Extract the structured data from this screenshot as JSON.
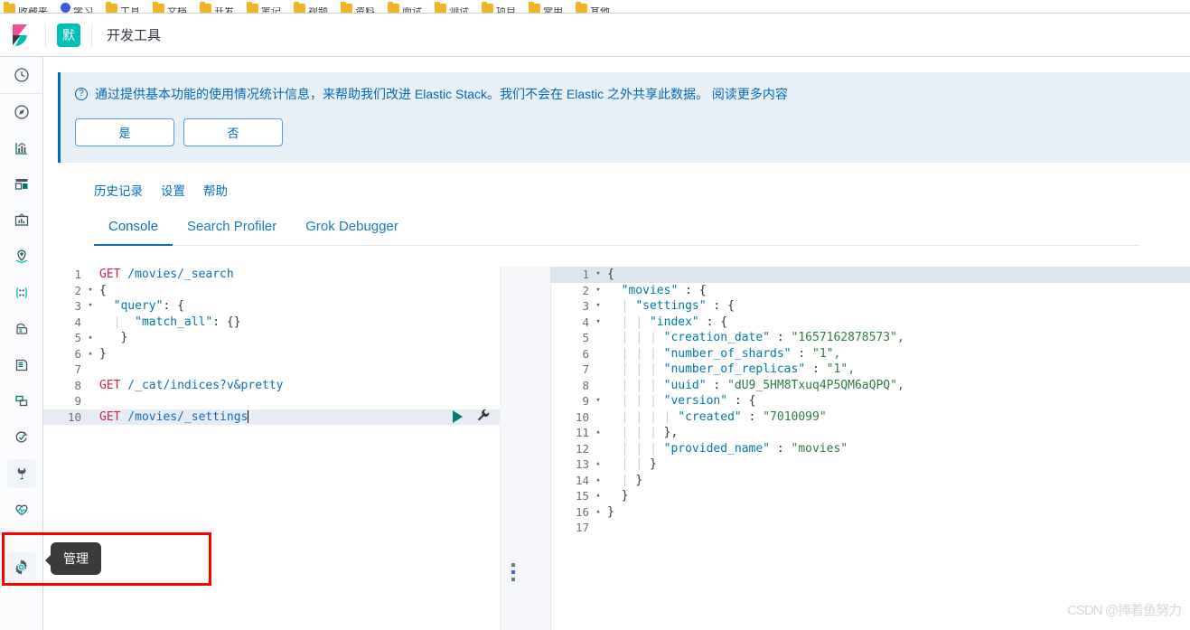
{
  "browser": {
    "bookmarks": [
      {
        "icon": "folder-icon",
        "label": "收藏夹"
      },
      {
        "icon": "globe-icon",
        "label": "学习"
      },
      {
        "icon": "folder-icon",
        "label": "工具"
      },
      {
        "icon": "folder-icon",
        "label": "文档"
      },
      {
        "icon": "folder-icon",
        "label": "开发"
      },
      {
        "icon": "folder-icon",
        "label": "笔记"
      },
      {
        "icon": "folder-icon",
        "label": "视频"
      },
      {
        "icon": "folder-icon",
        "label": "资料"
      },
      {
        "icon": "folder-icon",
        "label": "面试"
      },
      {
        "icon": "folder-icon",
        "label": "测试"
      },
      {
        "icon": "folder-icon",
        "label": "项目"
      },
      {
        "icon": "folder-icon",
        "label": "常用"
      },
      {
        "icon": "folder-icon",
        "label": "其他"
      }
    ]
  },
  "header": {
    "logo": "kibana-logo",
    "space_badge": "默",
    "title": "开发工具"
  },
  "sidebar": {
    "items": [
      {
        "name": "recently-viewed",
        "icon": "clock-icon",
        "active": false
      },
      {
        "name": "discover",
        "icon": "compass-icon",
        "active": false
      },
      {
        "name": "visualize",
        "icon": "chart-icon",
        "active": false
      },
      {
        "name": "dashboard",
        "icon": "dashboard-icon",
        "active": false
      },
      {
        "name": "canvas",
        "icon": "canvas-icon",
        "active": false
      },
      {
        "name": "maps",
        "icon": "map-marker-icon",
        "active": false
      },
      {
        "name": "machine-learning",
        "icon": "ml-icon",
        "active": false
      },
      {
        "name": "infrastructure",
        "icon": "server-icon",
        "active": false
      },
      {
        "name": "logs",
        "icon": "logs-icon",
        "active": false
      },
      {
        "name": "apm",
        "icon": "apm-icon",
        "active": false
      },
      {
        "name": "uptime",
        "icon": "uptime-icon",
        "active": false
      },
      {
        "name": "dev-tools",
        "icon": "wrench-icon",
        "active": true
      },
      {
        "name": "monitoring",
        "icon": "heartbeat-icon",
        "active": false
      },
      {
        "name": "management",
        "icon": "gear-icon",
        "active": true
      }
    ],
    "tooltip": "管理"
  },
  "callout": {
    "icon": "question-circle-icon",
    "text": "通过提供基本功能的使用情况统计信息，来帮助我们改进 Elastic Stack。我们不会在 Elastic 之外共享此数据。 阅读更多内容",
    "yes_label": "是",
    "no_label": "否"
  },
  "subnav": {
    "links": [
      {
        "label": "历史记录"
      },
      {
        "label": "设置"
      },
      {
        "label": "帮助"
      }
    ]
  },
  "tabs": [
    {
      "label": "Console",
      "active": true
    },
    {
      "label": "Search Profiler",
      "active": false
    },
    {
      "label": "Grok Debugger",
      "active": false
    }
  ],
  "editor": {
    "lines": [
      {
        "num": "1",
        "fold": "",
        "text": "GET /movies/_search",
        "type": "request",
        "method": "GET",
        "url": " /movies/_search"
      },
      {
        "num": "2",
        "fold": "▾",
        "text": "{",
        "type": "punct"
      },
      {
        "num": "3",
        "fold": "▾",
        "text": "  \"query\": {",
        "type": "keyopen",
        "key": "\"query\"",
        "tail": ": {"
      },
      {
        "num": "4",
        "fold": "",
        "text": "  |  \"match_all\": {}",
        "type": "keyval",
        "key": "\"match_all\"",
        "tail": ": {}"
      },
      {
        "num": "5",
        "fold": "▴",
        "text": "   }",
        "type": "punct"
      },
      {
        "num": "6",
        "fold": "▴",
        "text": "}",
        "type": "punct"
      },
      {
        "num": "7",
        "fold": "",
        "text": "",
        "type": "blank"
      },
      {
        "num": "8",
        "fold": "",
        "text": "GET /_cat/indices?v&pretty",
        "type": "request",
        "method": "GET",
        "url": " /_cat/indices?v&pretty"
      },
      {
        "num": "9",
        "fold": "",
        "text": "",
        "type": "blank"
      },
      {
        "num": "10",
        "fold": "",
        "text": "GET /movies/_settings",
        "type": "request",
        "method": "GET",
        "url": " /movies/_settings",
        "active": true
      }
    ],
    "actions": {
      "run": "play-icon",
      "wrench": "wrench-icon"
    }
  },
  "response": {
    "lines": [
      {
        "num": "1",
        "fold": "▾",
        "indent": 0,
        "text": "{",
        "active": true
      },
      {
        "num": "2",
        "fold": "▾",
        "indent": 1,
        "key": "\"movies\"",
        "sep": " : ",
        "val": "{"
      },
      {
        "num": "3",
        "fold": "▾",
        "indent": 2,
        "key": "\"settings\"",
        "sep": " : ",
        "val": "{"
      },
      {
        "num": "4",
        "fold": "▾",
        "indent": 3,
        "key": "\"index\"",
        "sep": " : ",
        "val": "{"
      },
      {
        "num": "5",
        "fold": "",
        "indent": 4,
        "key": "\"creation_date\"",
        "sep": " : ",
        "val": "\"1657162878573\",",
        "str": true
      },
      {
        "num": "6",
        "fold": "",
        "indent": 4,
        "key": "\"number_of_shards\"",
        "sep": " : ",
        "val": "\"1\",",
        "str": true
      },
      {
        "num": "7",
        "fold": "",
        "indent": 4,
        "key": "\"number_of_replicas\"",
        "sep": " : ",
        "val": "\"1\",",
        "str": true
      },
      {
        "num": "8",
        "fold": "",
        "indent": 4,
        "key": "\"uuid\"",
        "sep": " : ",
        "val": "\"dU9_5HM8Txuq4P5QM6aQPQ\",",
        "str": true
      },
      {
        "num": "9",
        "fold": "▾",
        "indent": 4,
        "key": "\"version\"",
        "sep": " : ",
        "val": "{"
      },
      {
        "num": "10",
        "fold": "",
        "indent": 5,
        "key": "\"created\"",
        "sep": " : ",
        "val": "\"7010099\"",
        "str": true
      },
      {
        "num": "11",
        "fold": "▴",
        "indent": 4,
        "text": "},"
      },
      {
        "num": "12",
        "fold": "",
        "indent": 4,
        "key": "\"provided_name\"",
        "sep": " : ",
        "val": "\"movies\"",
        "str": true
      },
      {
        "num": "13",
        "fold": "▴",
        "indent": 3,
        "text": "}"
      },
      {
        "num": "14",
        "fold": "▴",
        "indent": 2,
        "text": "}"
      },
      {
        "num": "15",
        "fold": "▴",
        "indent": 1,
        "text": "}"
      },
      {
        "num": "16",
        "fold": "▴",
        "indent": 0,
        "text": "}"
      },
      {
        "num": "17",
        "fold": "",
        "indent": 0,
        "text": ""
      }
    ]
  },
  "splitter": {
    "grip": "drag-handle-icon"
  },
  "watermark": {
    "text": "CSDN @捧着鱼努力"
  },
  "colors": {
    "brand_blue": "#006bb4",
    "teal": "#00bfb3",
    "pink": "#f04e98",
    "callout_bg": "#e7f0f7",
    "annotation_red": "#fe0000",
    "method": "#c7254e",
    "string": "#2d7d46",
    "json_key": "#0079a5"
  }
}
